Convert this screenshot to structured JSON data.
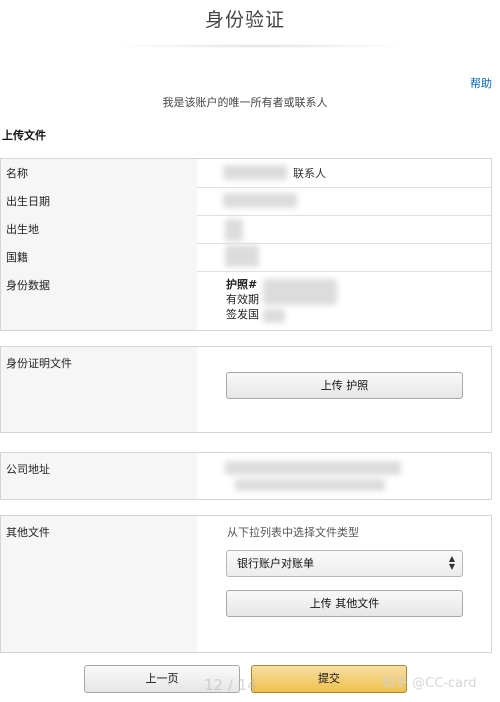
{
  "page": {
    "title": "身份验证",
    "help_link": "帮助",
    "subtitle": "我是该账户的唯一所有者或联系人",
    "section_title": "上传文件"
  },
  "info_table": {
    "rows": [
      {
        "label": "名称",
        "value": "联系人"
      },
      {
        "label": "出生日期",
        "value": ""
      },
      {
        "label": "出生地",
        "value": ""
      },
      {
        "label": "国籍",
        "value": ""
      },
      {
        "label": "身份数据",
        "lines": [
          "护照#",
          "有效期",
          "签发国"
        ]
      }
    ]
  },
  "id_document": {
    "label": "身份证明文件",
    "upload_button": "上传 护照"
  },
  "company_address": {
    "label": "公司地址"
  },
  "other_files": {
    "label": "其他文件",
    "hint": "从下拉列表中选择文件类型",
    "selected_type": "银行账户对账单",
    "upload_button": "上传 其他文件"
  },
  "footer": {
    "prev_button": "上一页",
    "submit_button": "提交",
    "page_indicator": "12 / 14",
    "watermark": "知乎 @CC-card"
  },
  "colors": {
    "link": "#0066c0",
    "submit_bg": "#f0c14b",
    "label_bg": "#f6f6f6",
    "border": "#d5d5d5"
  }
}
